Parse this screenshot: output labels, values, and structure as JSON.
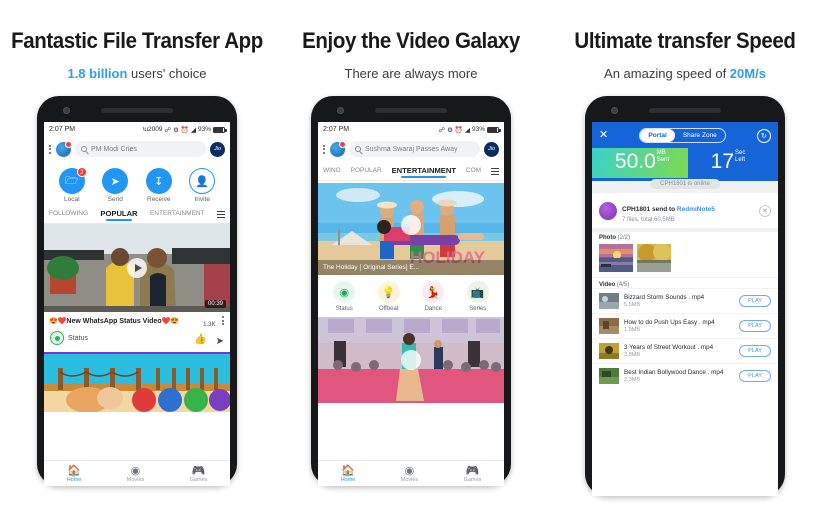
{
  "panels": [
    {
      "heading": "Fantastic File Transfer App",
      "sub_accent": "1.8 billion",
      "sub_rest": " users' choice",
      "phone": {
        "status": {
          "time": "2:07 PM",
          "battery": "93%"
        },
        "search": {
          "value": "PM Modi Cries",
          "brand": "Jio"
        },
        "actions": [
          {
            "label": "Local",
            "icon": "folder-icon",
            "badge": "2"
          },
          {
            "label": "Send",
            "icon": "send-icon",
            "badge": ""
          },
          {
            "label": "Receive",
            "icon": "receive-icon",
            "badge": ""
          },
          {
            "label": "Invite",
            "icon": "invite-icon",
            "badge": ""
          }
        ],
        "tabs": [
          {
            "label": "FOLLOWING",
            "active": false
          },
          {
            "label": "POPULAR",
            "active": true
          },
          {
            "label": "ENTERTAINMENT",
            "active": false
          }
        ],
        "video": {
          "duration": "00:39",
          "title": "😍❤️New WhatsApp Status Video❤️😍",
          "channel": "Status",
          "likes": "1.3K"
        },
        "nav": [
          {
            "label": "Home",
            "icon": "home-icon",
            "active": true
          },
          {
            "label": "Movies",
            "icon": "movies-icon",
            "active": false
          },
          {
            "label": "Games",
            "icon": "games-icon",
            "active": false
          }
        ]
      }
    },
    {
      "heading": "Enjoy the Video Galaxy",
      "sub_accent": "",
      "sub_rest": "There are always more",
      "phone": {
        "status": {
          "time": "2:07 PM",
          "battery": "93%"
        },
        "search": {
          "value": "Sushma Swaraj Passes Away",
          "brand": "Jio"
        },
        "tabs": [
          {
            "label": "WING",
            "active": false
          },
          {
            "label": "POPULAR",
            "active": false
          },
          {
            "label": "ENTERTAINMENT",
            "active": true
          },
          {
            "label": "COM",
            "active": false
          }
        ],
        "hero_caption": "The Holiday [ Original Series] E...",
        "categories": [
          {
            "label": "Status",
            "icon": "status-icon"
          },
          {
            "label": "Offbeat",
            "icon": "bulb-icon"
          },
          {
            "label": "Dance",
            "icon": "dance-icon"
          },
          {
            "label": "Series",
            "icon": "tv-icon"
          }
        ],
        "nav": [
          {
            "label": "Home",
            "icon": "home-icon",
            "active": true
          },
          {
            "label": "Movies",
            "icon": "movies-icon",
            "active": false
          },
          {
            "label": "Games",
            "icon": "games-icon",
            "active": false
          }
        ]
      }
    },
    {
      "heading": "Ultimate transfer Speed",
      "sub_accent": "20M/s",
      "sub_rest": "An amazing speed of ",
      "phone": {
        "toggle": {
          "left": "Portal",
          "right": "Share Zone",
          "selected": "Portal"
        },
        "speed": {
          "value": "50.0",
          "unit_top": "MB",
          "unit_bottom": "Sent"
        },
        "time_left": {
          "value": "17",
          "unit_top": "Sec",
          "unit_bottom": "Left"
        },
        "online_pill": "CPH1801 is online",
        "transfer": {
          "title_prefix": "CPH1801 send to ",
          "title_target": "RedmiNote5",
          "subtitle": "7 files, total 60.5MB"
        },
        "photo_section": {
          "label": "Photo",
          "count": "(2/2)"
        },
        "video_section": {
          "label": "Video",
          "count": "(4/5)"
        },
        "files": [
          {
            "name": "Bizzard Storm Sounds . mp4",
            "size": "5.5MB",
            "action": "PLAY"
          },
          {
            "name": "How to do Push Ups Easy . mp4",
            "size": "1.9MB",
            "action": "PLAY"
          },
          {
            "name": "3 Years of Street Workout . mp4",
            "size": "3.8MB",
            "action": "PLAY"
          },
          {
            "name": "Best Indian Bollywood Dance . mp4",
            "size": "2.3MB",
            "action": "PLAY"
          }
        ]
      }
    }
  ],
  "colors": {
    "accent": "#2f9fe0",
    "primary_blue": "#2196f3",
    "header_blue": "#1565d8",
    "badge_red": "#f23a2f"
  }
}
